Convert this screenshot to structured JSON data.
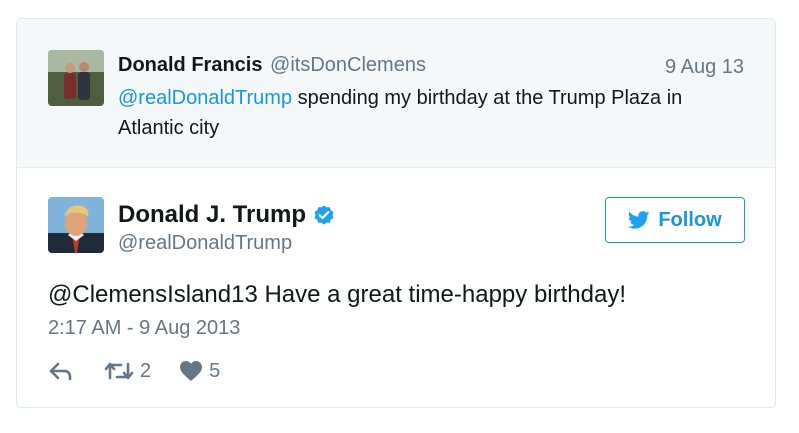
{
  "parent_tweet": {
    "author_name": "Donald Francis",
    "author_handle": "@itsDonClemens",
    "date": "9 Aug 13",
    "mention": "@realDonaldTrump",
    "text": " spending my birthday at the Trump Plaza in Atlantic city"
  },
  "main_tweet": {
    "author_name": "Donald J. Trump",
    "author_handle": "@realDonaldTrump",
    "verified_icon": "verified-badge-icon",
    "follow_label": "Follow",
    "text": "@ClemensIsland13 Have a great time-happy birthday!",
    "timestamp": "2:17 AM - 9 Aug 2013",
    "actions": {
      "reply_icon": "reply-icon",
      "retweet_icon": "retweet-icon",
      "retweet_count": "2",
      "like_icon": "heart-icon",
      "like_count": "5"
    }
  },
  "colors": {
    "accent": "#1b95e0",
    "text": "#14171a",
    "muted": "#657786",
    "parent_bg": "#f5f8fa"
  }
}
